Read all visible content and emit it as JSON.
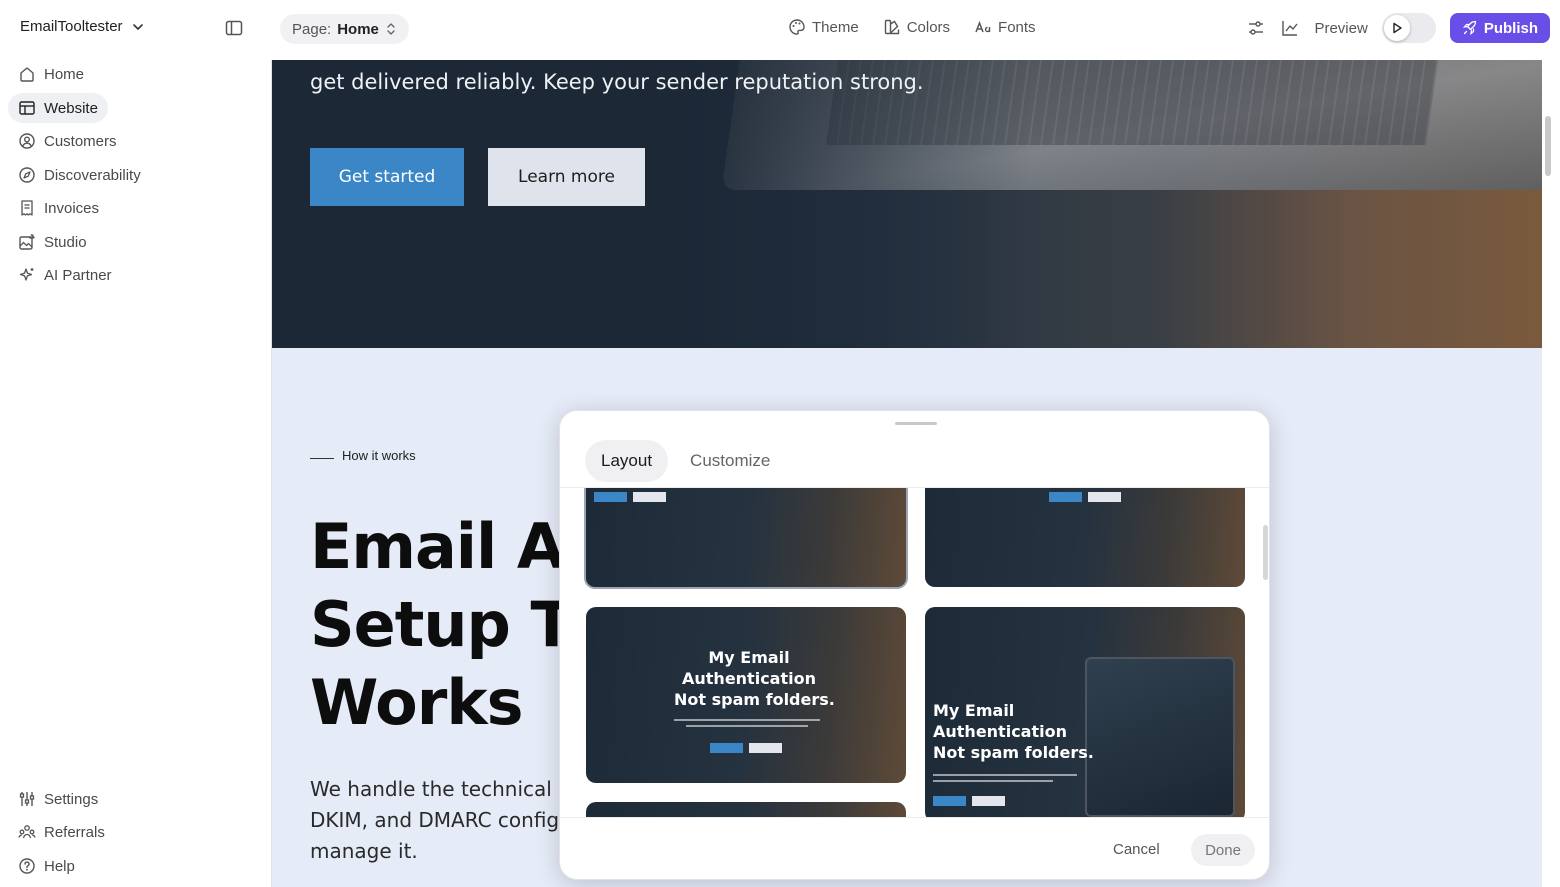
{
  "topbar": {
    "brand": "EmailTooltester",
    "page_prefix": "Page:",
    "page_name": "Home",
    "theme_label": "Theme",
    "colors_label": "Colors",
    "fonts_label": "Fonts",
    "preview_label": "Preview",
    "publish_label": "Publish"
  },
  "sidebar": {
    "items": [
      {
        "label": "Home",
        "icon": "home-icon"
      },
      {
        "label": "Website",
        "icon": "layout-icon",
        "active": true
      },
      {
        "label": "Customers",
        "icon": "user-circle-icon"
      },
      {
        "label": "Discoverability",
        "icon": "compass-icon"
      },
      {
        "label": "Invoices",
        "icon": "receipt-icon"
      },
      {
        "label": "Studio",
        "icon": "image-edit-icon"
      },
      {
        "label": "AI Partner",
        "icon": "sparkle-icon"
      }
    ],
    "bottom_items": [
      {
        "label": "Settings",
        "icon": "sliders-icon"
      },
      {
        "label": "Referrals",
        "icon": "users-icon"
      },
      {
        "label": "Help",
        "icon": "help-circle-icon"
      }
    ]
  },
  "hero": {
    "lead": "get delivered reliably. Keep your sender reputation strong.",
    "primary_button": "Get started",
    "secondary_button": "Learn more"
  },
  "section": {
    "eyebrow": "How it works",
    "title_lines": [
      "Email Au",
      "Setup Th",
      "Works"
    ],
    "body_lines": [
      "We handle the technical se",
      "DKIM, and DMARC configu",
      "manage it."
    ]
  },
  "modal": {
    "tabs": [
      "Layout",
      "Customize"
    ],
    "active_tab": "Layout",
    "thumb_title_lines": [
      "My Email",
      "Authentication",
      "Not spam folders."
    ],
    "cancel_label": "Cancel",
    "done_label": "Done"
  },
  "colors": {
    "accent": "#6a4ee8",
    "hero_button": "#3b86c6",
    "canvas_bg": "#e6ebf8"
  }
}
